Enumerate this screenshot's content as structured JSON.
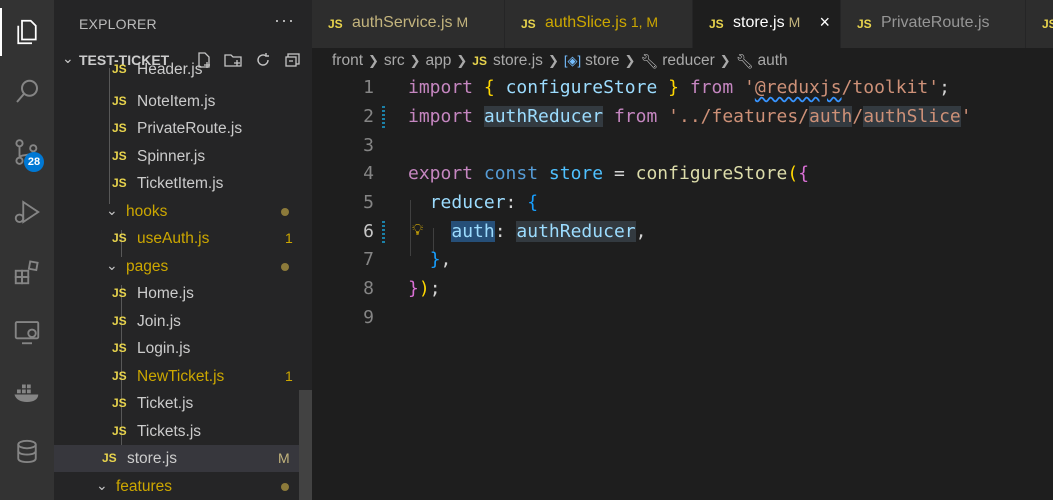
{
  "activity_bar": {
    "items": [
      {
        "icon": "explorer-icon"
      },
      {
        "icon": "search-icon"
      },
      {
        "icon": "source-control-icon",
        "badge": "28"
      },
      {
        "icon": "run-debug-icon"
      },
      {
        "icon": "extensions-icon"
      },
      {
        "icon": "remote-explorer-icon"
      },
      {
        "icon": "docker-icon"
      },
      {
        "icon": "database-icon"
      }
    ]
  },
  "sidebar": {
    "title": "EXPLORER",
    "more": "···",
    "root": "TEST-TICKET",
    "items": [
      {
        "name": "Header.js",
        "type": "js"
      },
      {
        "name": "NoteItem.js",
        "type": "js"
      },
      {
        "name": "PrivateRoute.js",
        "type": "js"
      },
      {
        "name": "Spinner.js",
        "type": "js"
      },
      {
        "name": "TicketItem.js",
        "type": "js"
      },
      {
        "name": "hooks",
        "type": "folder"
      },
      {
        "name": "useAuth.js",
        "type": "js",
        "status": "1"
      },
      {
        "name": "pages",
        "type": "folder"
      },
      {
        "name": "Home.js",
        "type": "js"
      },
      {
        "name": "Join.js",
        "type": "js"
      },
      {
        "name": "Login.js",
        "type": "js"
      },
      {
        "name": "NewTicket.js",
        "type": "js",
        "status": "1"
      },
      {
        "name": "Ticket.js",
        "type": "js"
      },
      {
        "name": "Tickets.js",
        "type": "js"
      },
      {
        "name": "store.js",
        "type": "js",
        "status": "M"
      },
      {
        "name": "features",
        "type": "folder"
      }
    ]
  },
  "tabs": [
    {
      "label": "authService.js",
      "status": "M"
    },
    {
      "label": "authSlice.js",
      "status": "1, M"
    },
    {
      "label": "store.js",
      "status": "M",
      "close": "×"
    },
    {
      "label": "PrivateRoute.js",
      "status": ""
    }
  ],
  "js_icon": "JS",
  "breadcrumb": {
    "parts": [
      "front",
      "src",
      "app"
    ],
    "file": "store.js",
    "symbols": [
      "store",
      "reducer",
      "auth"
    ]
  },
  "editor": {
    "line_numbers": [
      "1",
      "2",
      "3",
      "4",
      "5",
      "6",
      "7",
      "8",
      "9"
    ],
    "l1": {
      "kw": "import",
      "b_open": "{",
      "name": "configureStore",
      "b_close": "}",
      "from": "from",
      "q": "'",
      "sq": "@reduxjs",
      "rest": "/toolkit'",
      "semi": ";"
    },
    "l2": {
      "kw": "import",
      "name": "authReducer",
      "from": "from",
      "s1": "'../features/",
      "s2": "auth",
      "s3": "/",
      "s4": "authSlice",
      "s5": "'"
    },
    "l4": {
      "kw": "export",
      "kw2": "const",
      "name": "store",
      "eq": "=",
      "fn": "configureStore",
      "p": "(",
      "b": "{"
    },
    "l5": {
      "key": "reducer",
      "colon": ":",
      "b": "{"
    },
    "l6": {
      "key": "auth",
      "colon": ":",
      "val": "authReducer",
      "comma": ","
    },
    "l7": {
      "b": "}",
      "comma": ","
    },
    "l8": {
      "b": "}",
      "p": ")",
      "semi": ";"
    }
  }
}
